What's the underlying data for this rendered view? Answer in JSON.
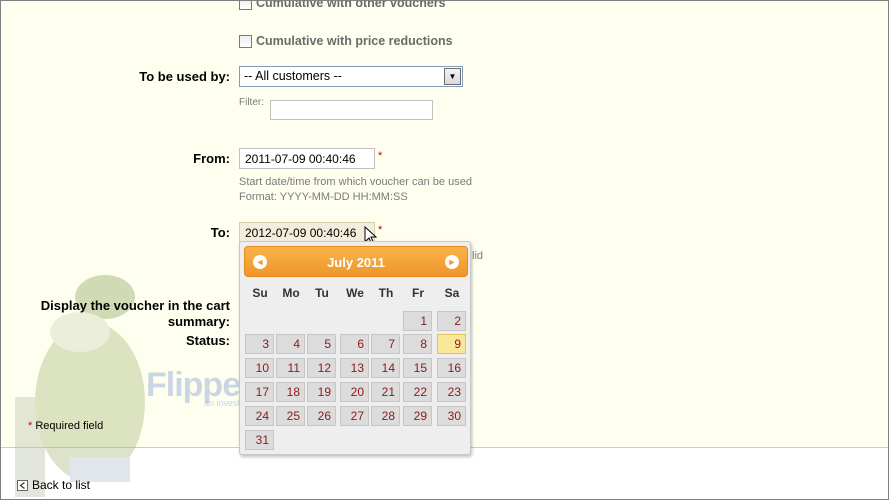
{
  "form": {
    "cb_cumulative_vouchers": "Cumulative with other vouchers",
    "cb_cumulative_price": "Cumulative with price reductions",
    "used_by_label": "To be used by:",
    "used_by_value": "-- All customers --",
    "filter_label": "Filter:",
    "from_label": "From:",
    "from_value": "2011-07-09 00:40:46",
    "from_help1": "Start date/time from which voucher can be used",
    "from_help2": "Format: YYYY-MM-DD HH:MM:SS",
    "to_label": "To:",
    "to_value": "2012-07-09 00:40:46",
    "to_help_fragment": "lid",
    "required_star": "*",
    "display_label_1": "Display the voucher in the cart",
    "display_label_2": "summary:",
    "status_label": "Status:",
    "required_note": "Required field"
  },
  "datepicker": {
    "title": "July 2011",
    "prev": "◄",
    "next": "►",
    "weekdays": [
      "Su",
      "Mo",
      "Tu",
      "We",
      "Th",
      "Fr",
      "Sa"
    ],
    "rows": [
      [
        "",
        "",
        "",
        "",
        "",
        "1",
        "2"
      ],
      [
        "3",
        "4",
        "5",
        "6",
        "7",
        "8",
        "9"
      ],
      [
        "10",
        "11",
        "12",
        "13",
        "14",
        "15",
        "16"
      ],
      [
        "17",
        "18",
        "19",
        "20",
        "21",
        "22",
        "23"
      ],
      [
        "24",
        "25",
        "26",
        "27",
        "28",
        "29",
        "30"
      ],
      [
        "31",
        "",
        "",
        "",
        "",
        "",
        ""
      ]
    ],
    "selected": "9"
  },
  "watermark": {
    "brand": "FlipperHost",
    "tagline": "an investment"
  },
  "footer": {
    "back_label": "Back to list"
  },
  "colors": {
    "accent": "#f0952a",
    "day_text": "#8b1a1a",
    "required": "#cc0000"
  }
}
